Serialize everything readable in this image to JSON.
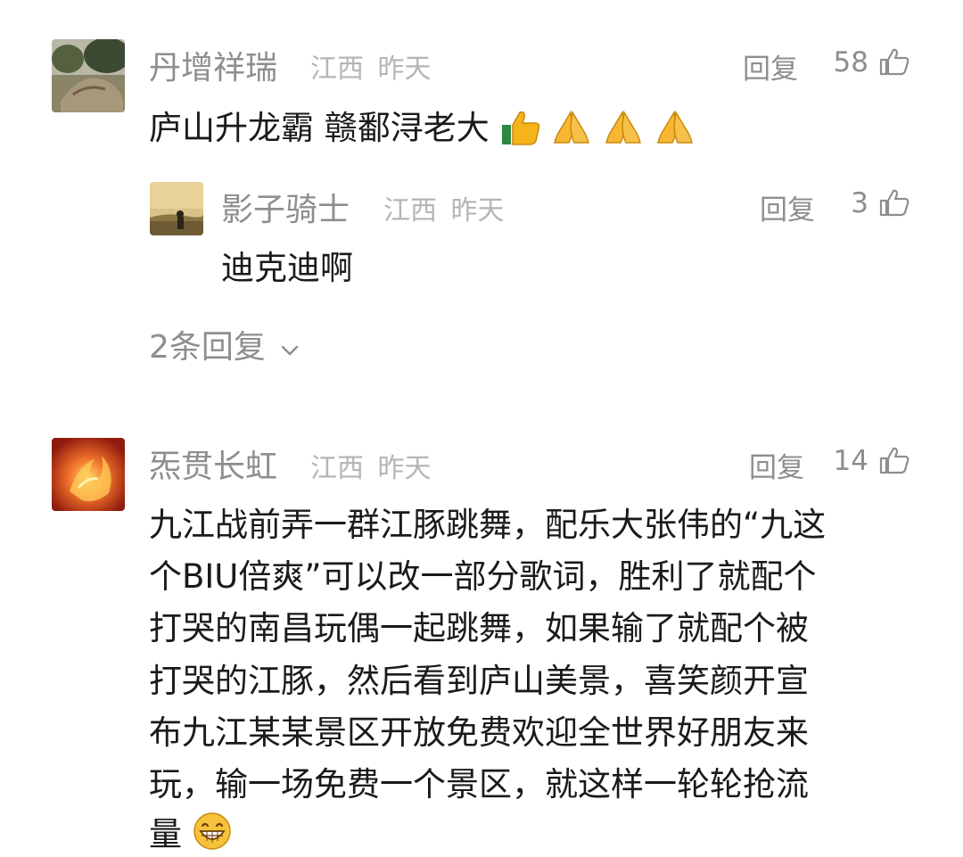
{
  "comments": [
    {
      "username": "丹增祥瑞",
      "location": "江西",
      "time": "昨天",
      "reply_label": "回复",
      "likes": "58",
      "text": "庐山升龙霸  赣鄱浔老大",
      "emojis": [
        "thumbs-up-icon",
        "pray-icon",
        "pray-icon",
        "pray-icon"
      ],
      "replies": [
        {
          "username": "影子骑士",
          "location": "江西",
          "time": "昨天",
          "reply_label": "回复",
          "likes": "3",
          "text": "迪克迪啊"
        }
      ],
      "more_replies": "2条回复"
    },
    {
      "username": "炁贯长虹",
      "location": "江西",
      "time": "昨天",
      "reply_label": "回复",
      "likes": "14",
      "lines": [
        "九江战前弄一群江豚跳舞，配乐大张伟的“九这",
        "个BIU倍爽”可以改一部分歌词，胜利了就配个",
        "打哭的南昌玩偶一起跳舞，如果输了就配个被",
        "打哭的江豚，然后看到庐山美景，喜笑颜开宣",
        "布九江某某景区开放免费欢迎全世界好朋友来",
        "玩，输一场免费一个景区，就这样一轮轮抢流",
        "量"
      ],
      "emojis": [
        "grin-icon"
      ]
    }
  ]
}
